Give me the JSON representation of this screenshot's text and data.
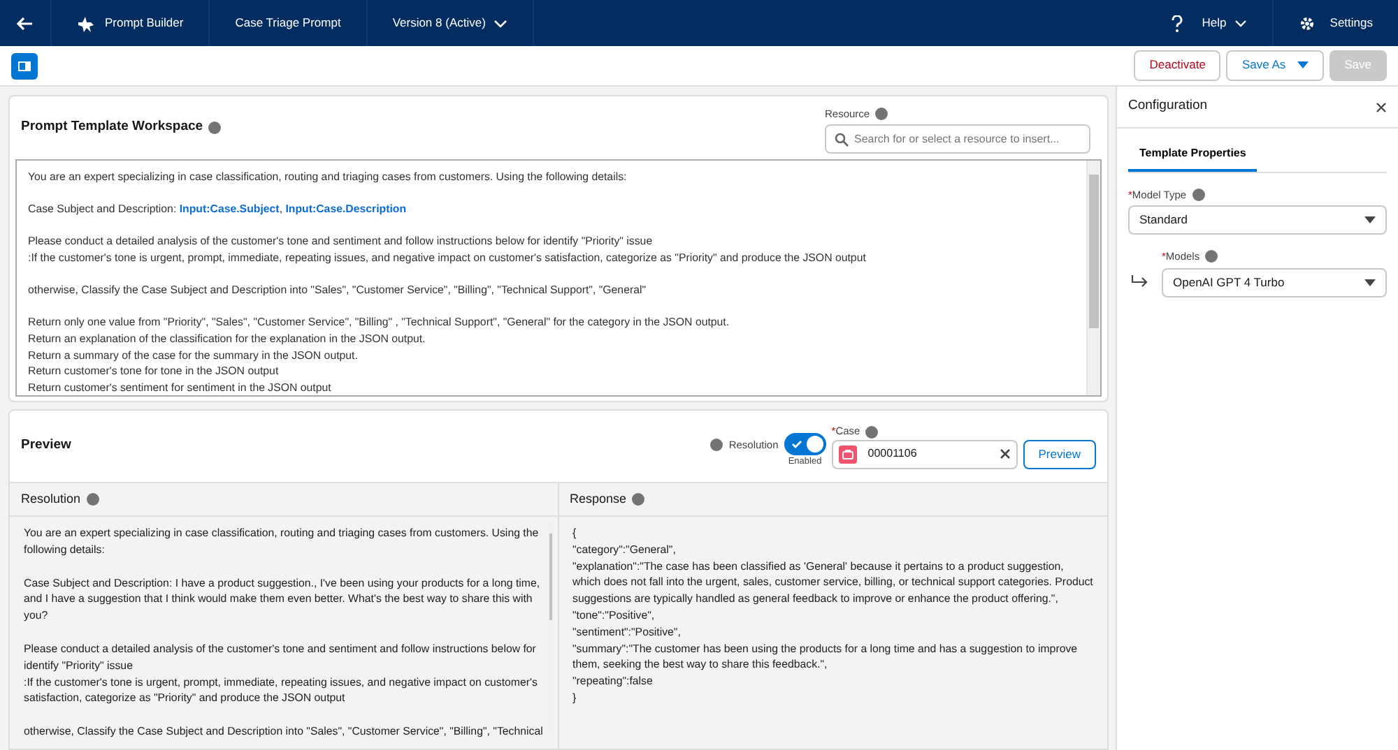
{
  "header": {
    "app_name": "Prompt Builder",
    "tabs": [
      {
        "label": "Case Triage Prompt",
        "kind": "text"
      },
      {
        "label": "Version 8 (Active)",
        "kind": "dropdown"
      }
    ],
    "help": "Help",
    "settings": "Settings"
  },
  "toolbar": {
    "buttons": [
      {
        "label": "Deactivate",
        "kind": "destructive",
        "disabled": false
      },
      {
        "label": "Save As",
        "kind": "menu",
        "disabled": false
      },
      {
        "label": "Save",
        "kind": "plain",
        "disabled": true
      }
    ]
  },
  "workspace": {
    "title": "Prompt Template Workspace",
    "resource": {
      "label": "Resource",
      "placeholder": "Search for or select a resource to insert..."
    },
    "paragraphs": [
      [
        "You are an expert specializing in case classification, routing and triaging cases from customers. Using the following details:"
      ],
      [
        "Case Subject and Description: **Input:Case.Subject**, **Input:Case.Description**"
      ],
      [
        "Please conduct a detailed analysis of the customer's tone and sentiment and follow instructions below for identify \"Priority\" issue",
        " :If the customer's tone is urgent, prompt, immediate, repeating issues, and negative impact on customer's satisfaction, categorize as \"Priority\" and produce the JSON output"
      ],
      [
        "otherwise, Classify the Case Subject and Description into \"Sales\", \"Customer Service\", \"Billing\", \"Technical Support\", \"General\""
      ],
      [
        "Return only one value from \"Priority\", \"Sales\", \"Customer Service\", \"Billing\" , \"Technical Support\", \"General\" for the category in the JSON output.",
        "Return an explanation of the classification for the explanation in the JSON output.",
        "Return a summary of the case for the summary in the JSON output.",
        "Return customer's tone for tone in the JSON output",
        "Return customer's sentiment for sentiment in the JSON output"
      ]
    ]
  },
  "required_mark": "*",
  "preview": {
    "title": "Preview",
    "resolution_toggle": {
      "label": "Resolution",
      "on": true,
      "state_text": "Enabled"
    },
    "case": {
      "label": "Case",
      "value": "00001106",
      "required": true
    },
    "button": "Preview",
    "resolution": {
      "title": "Resolution",
      "paragraphs": [
        [
          "You are an expert specializing in case classification, routing and triaging cases from customers. Using the following details:"
        ],
        [
          "Case Subject and Description: I have a product suggestion., I've been using your products for a long time, and I have a suggestion that I think would make them even better.  What's the best way to share this with you?"
        ],
        [
          "Please conduct a detailed analysis of the customer's tone and sentiment and follow instructions below for identify \"Priority\" issue",
          " :If the customer's tone is urgent, prompt, immediate, repeating issues, and negative impact on customer's satisfaction, categorize as \"Priority\" and produce the JSON output"
        ],
        [
          "otherwise, Classify the Case Subject and Description into \"Sales\", \"Customer Service\", \"Billing\", \"Technical"
        ]
      ]
    },
    "response": {
      "title": "Response",
      "lines": [
        "{",
        "\"category\":\"General\",",
        "\"explanation\":\"The case has been classified as 'General' because it pertains to a product suggestion, which does not fall into the urgent, sales, customer service, billing, or technical support categories. Product suggestions are typically handled as general feedback to improve or enhance the product offering.\",",
        "\"tone\":\"Positive\",",
        "\"sentiment\":\"Positive\",",
        "\"summary\":\"The customer has been using the products for a long time and has a suggestion to improve them, seeking the best way to share this feedback.\",",
        "\"repeating\":false",
        "}"
      ]
    }
  },
  "configuration": {
    "title": "Configuration",
    "tabs": [
      {
        "label": "Template Properties",
        "selected": true
      }
    ],
    "fields": [
      {
        "label": "Model Type",
        "value": "Standard",
        "required": true,
        "nested": false
      },
      {
        "label": "Models",
        "value": "OpenAI GPT 4 Turbo",
        "required": true,
        "nested": true
      }
    ]
  }
}
